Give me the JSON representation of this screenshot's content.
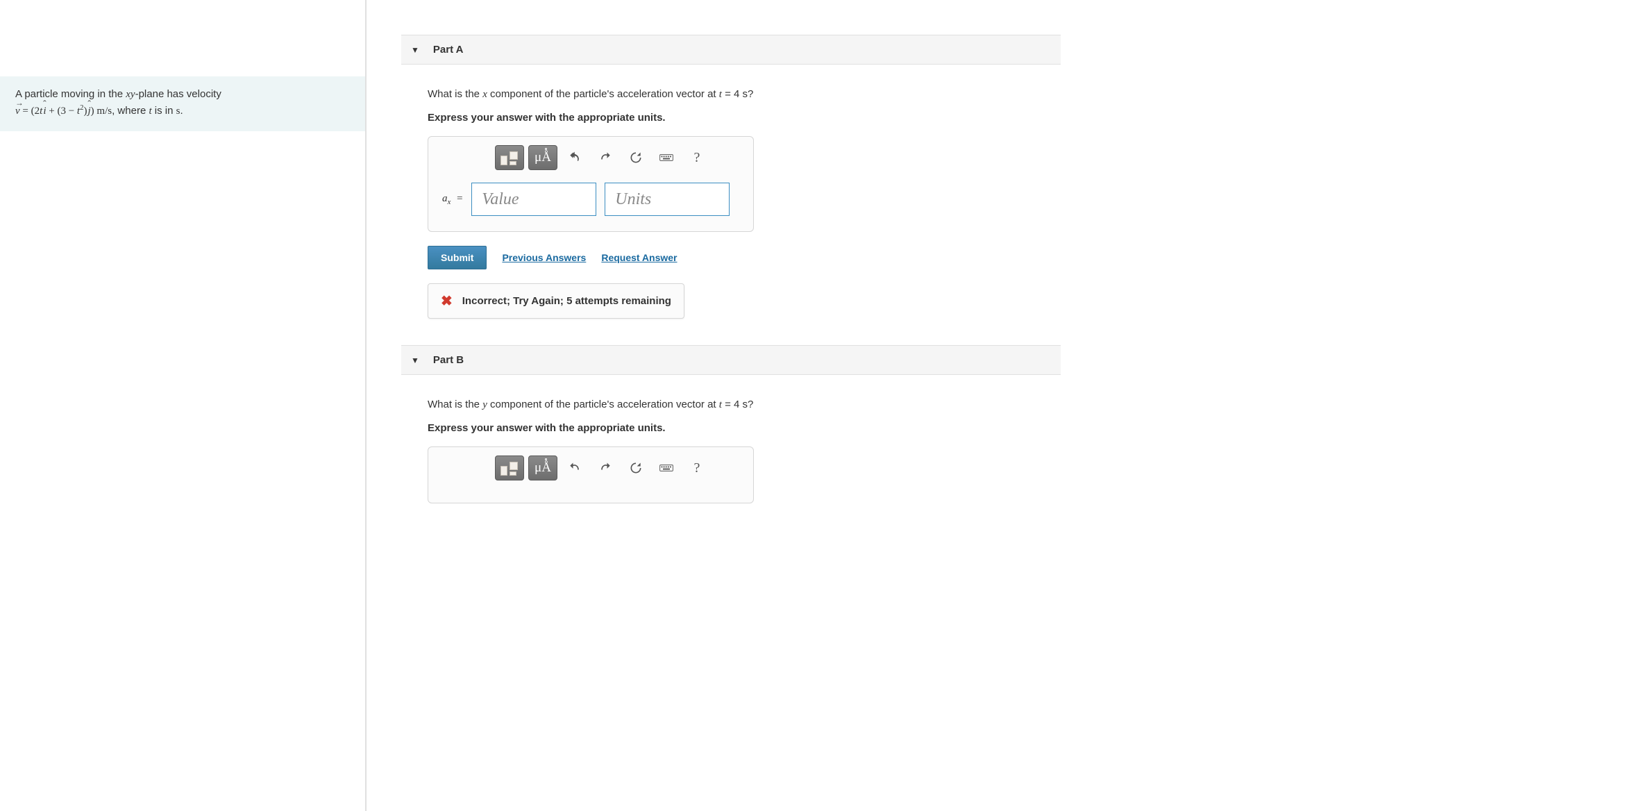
{
  "prompt": {
    "pre": "A particle moving in the ",
    "xy": "xy",
    "mid1": "-plane has velocity ",
    "v": "v",
    "eq": " = (2",
    "t1": "t",
    "ihat": "i",
    "plus": " + (3 − ",
    "t2": "t",
    "sq": "2",
    "close": ")",
    "jhat": "j",
    "end": ") ",
    "unit_m": "m",
    "slash": "/",
    "unit_s": "s",
    "tail": ", where ",
    "t3": "t",
    "tail2": " is in ",
    "unit_s2": "s",
    "period": "."
  },
  "partA": {
    "title": "Part A",
    "question_pre": "What is the ",
    "component": "x",
    "question_mid": " component of the particle's acceleration vector at ",
    "tvar": "t",
    "question_eq": " = 4 s?",
    "hint": "Express your answer with the appropriate units.",
    "lhs_a": "a",
    "lhs_sub": "x",
    "eq": " =",
    "value_ph": "Value",
    "units_ph": "Units",
    "submit": "Submit",
    "prev": "Previous Answers",
    "request": "Request Answer",
    "feedback": "Incorrect; Try Again; 5 attempts remaining"
  },
  "partB": {
    "title": "Part B",
    "question_pre": "What is the ",
    "component": "y",
    "question_mid": " component of the particle's acceleration vector at ",
    "tvar": "t",
    "question_eq": " = 4 s?",
    "hint": "Express your answer with the appropriate units."
  },
  "toolbar": {
    "mu": "μÅ",
    "help": "?"
  }
}
